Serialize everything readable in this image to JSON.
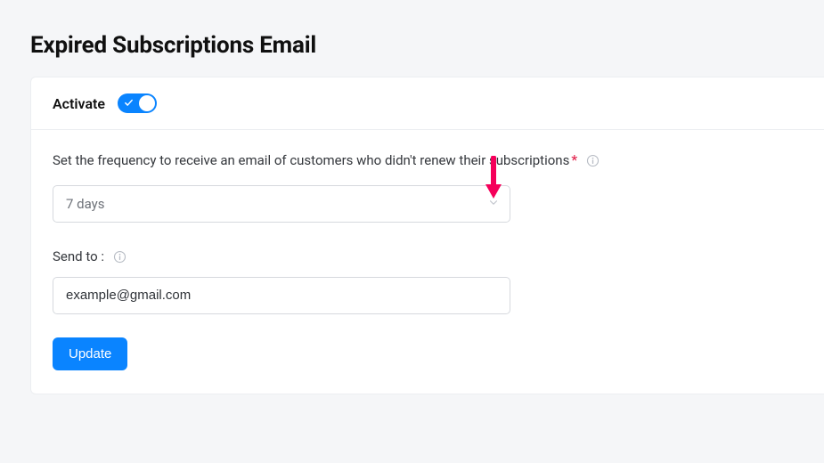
{
  "page": {
    "title": "Expired Subscriptions Email"
  },
  "header": {
    "activate_label": "Activate",
    "toggle_on": true
  },
  "form": {
    "frequency_label": "Set the frequency to receive an email of customers who didn't renew their subscriptions",
    "frequency_value": "7 days",
    "send_to_label": "Send to :",
    "send_to_value": "example@gmail.com",
    "update_label": "Update"
  },
  "annotation": {
    "arrow_color": "#f5005a"
  }
}
